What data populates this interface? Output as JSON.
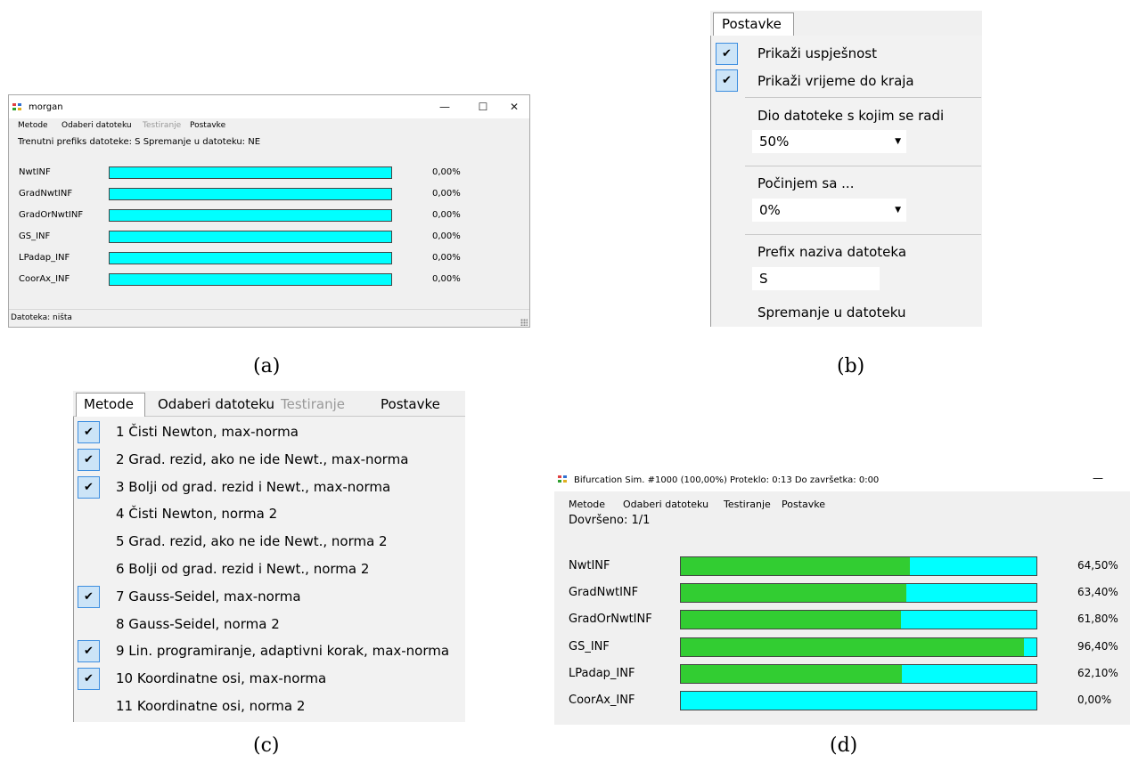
{
  "colors": {
    "accent_cyan": "#00ffff",
    "progress_green": "#32cd32",
    "check_bg": "#cce4f7",
    "check_border": "#3d8ee0"
  },
  "panel_a": {
    "title": "morgan",
    "window_buttons": {
      "minimize": "—",
      "maximize": "☐",
      "close": "✕"
    },
    "menu": {
      "metode": "Metode",
      "odaberi": "Odaberi datoteku",
      "testiranje": "Testiranje",
      "postavke": "Postavke"
    },
    "info_line": "Trenutni prefiks datoteke: S  Spremanje u datoteku: NE",
    "rows": [
      {
        "label": "NwtINF",
        "percent": "0,00%",
        "fill": 0
      },
      {
        "label": "GradNwtINF",
        "percent": "0,00%",
        "fill": 0
      },
      {
        "label": "GradOrNwtINF",
        "percent": "0,00%",
        "fill": 0
      },
      {
        "label": "GS_INF",
        "percent": "0,00%",
        "fill": 0
      },
      {
        "label": "LPadap_INF",
        "percent": "0,00%",
        "fill": 0
      },
      {
        "label": "CoorAx_INF",
        "percent": "0,00%",
        "fill": 0
      }
    ],
    "status": "Datoteka: ništa",
    "caption": "(a)"
  },
  "panel_b": {
    "menu_title": "Postavke",
    "check_mark": "✔",
    "items": {
      "show_success": "Prikaži uspješnost",
      "show_time": "Prikaži vrijeme do kraja",
      "file_part_label": "Dio datoteke s kojim se radi",
      "file_part_value": "50%",
      "start_label": "Počinjem sa ...",
      "start_value": "0%",
      "prefix_label": "Prefix naziva datoteka",
      "prefix_value": "S",
      "save_label": "Spremanje u datoteku"
    },
    "dropdown_arrow": "▼",
    "caption": "(b)"
  },
  "panel_c": {
    "menu": {
      "metode": "Metode",
      "odaberi": "Odaberi datoteku",
      "testiranje": "Testiranje",
      "postavke": "Postavke"
    },
    "check_mark": "✔",
    "items": [
      {
        "label": "1 Čisti Newton, max-norma",
        "checked": true
      },
      {
        "label": "2 Grad. rezid, ako ne ide Newt., max-norma",
        "checked": true
      },
      {
        "label": "3 Bolji od grad. rezid i Newt., max-norma",
        "checked": true
      },
      {
        "label": "4 Čisti Newton, norma 2",
        "checked": false
      },
      {
        "label": "5 Grad. rezid, ako ne ide Newt., norma 2",
        "checked": false
      },
      {
        "label": "6 Bolji od grad. rezid i Newt., norma 2",
        "checked": false
      },
      {
        "label": "7 Gauss-Seidel, max-norma",
        "checked": true
      },
      {
        "label": "8 Gauss-Seidel, norma 2",
        "checked": false
      },
      {
        "label": "9 Lin. programiranje, adaptivni korak, max-norma",
        "checked": true
      },
      {
        "label": "10 Koordinatne osi, max-norma",
        "checked": true
      },
      {
        "label": "11 Koordinatne osi, norma 2",
        "checked": false
      }
    ],
    "caption": "(c)"
  },
  "panel_d": {
    "title": "Bifurcation Sim. #1000  (100,00%)  Proteklo: 0:13  Do završetka: 0:00",
    "minimize": "—",
    "menu": {
      "metode": "Metode",
      "odaberi": "Odaberi datoteku",
      "testiranje": "Testiranje",
      "postavke": "Postavke"
    },
    "done_line": "Dovršeno: 1/1",
    "rows": [
      {
        "label": "NwtINF",
        "percent": "64,50%",
        "fill": 0.645
      },
      {
        "label": "GradNwtINF",
        "percent": "63,40%",
        "fill": 0.634
      },
      {
        "label": "GradOrNwtINF",
        "percent": "61,80%",
        "fill": 0.618
      },
      {
        "label": "GS_INF",
        "percent": "96,40%",
        "fill": 0.964
      },
      {
        "label": "LPadap_INF",
        "percent": "62,10%",
        "fill": 0.621
      },
      {
        "label": "CoorAx_INF",
        "percent": "0,00%",
        "fill": 0
      }
    ],
    "caption": "(d)"
  }
}
